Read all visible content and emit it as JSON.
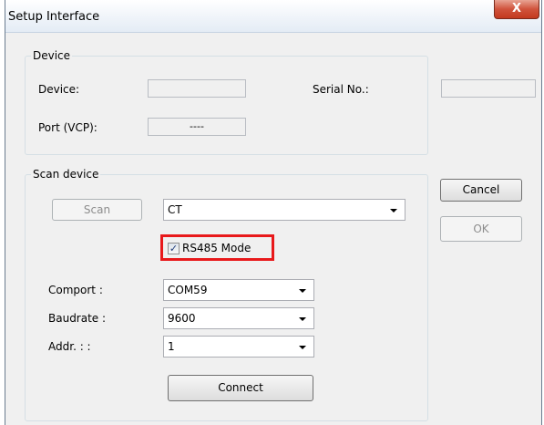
{
  "window": {
    "title": "Setup Interface",
    "close_glyph": "X"
  },
  "device_group": {
    "legend": "Device",
    "device_label": "Device:",
    "device_value": "",
    "serial_label": "Serial No.:",
    "serial_value": "",
    "port_label": "Port (VCP):",
    "port_value": "----"
  },
  "scan_group": {
    "legend": "Scan device",
    "scan_button": "Scan",
    "device_type": {
      "selected": "CT"
    },
    "rs485": {
      "label": "RS485 Mode",
      "checked": true,
      "check_glyph": "✓"
    },
    "comport_label": "Comport :",
    "comport": {
      "selected": "COM59"
    },
    "baudrate_label": "Baudrate :",
    "baudrate": {
      "selected": "9600"
    },
    "addr_label": "Addr. : :",
    "addr": {
      "selected": "1"
    },
    "connect_button": "Connect"
  },
  "actions": {
    "cancel_button": "Cancel",
    "ok_button": "OK"
  },
  "colors": {
    "highlight_border": "#e8191b",
    "close_button": "#c3391e"
  }
}
